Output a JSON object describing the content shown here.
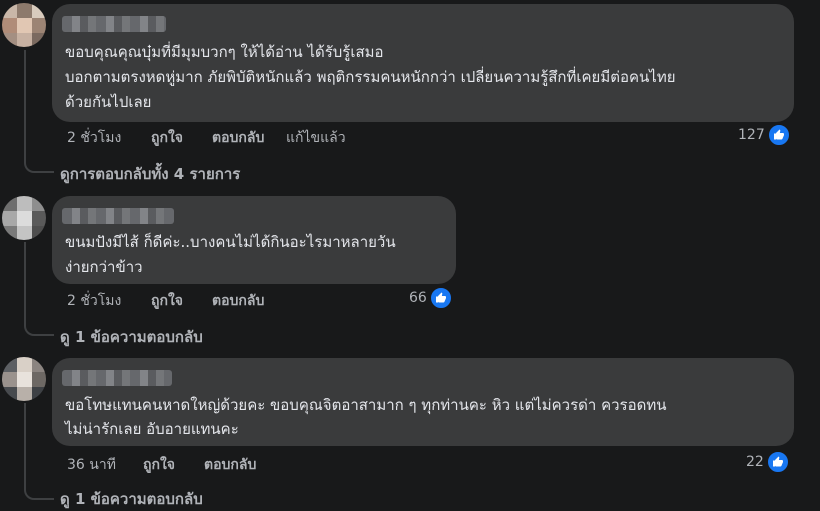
{
  "comments": [
    {
      "lines": [
        "ขอบคุณคุณบุ๋มที่มีมุมบวกๆ ให้ได้อ่าน ได้รับรู้เสมอ",
        "บอกตามตรงหดหู่มาก ภัยพิบัติหนักแล้ว พฤติกรรมคนหนักกว่า เปลี่ยนความรู้สึกที่เคยมีต่อคนไทย",
        "ด้วยกันไปเลย"
      ],
      "time": "2 ชั่วโมง",
      "like": "ถูกใจ",
      "reply": "ตอบกลับ",
      "edited": "แก้ไขแล้ว",
      "reaction_count": "127",
      "replies_link": "ดูการตอบกลับทั้ง 4 รายการ"
    },
    {
      "lines": [
        "ขนมปังมีไส้ ก็ดีค่ะ..บางคนไม่ได้กินอะไรมาหลายวัน",
        "ง่ายกว่าข้าว"
      ],
      "time": "2 ชั่วโมง",
      "like": "ถูกใจ",
      "reply": "ตอบกลับ",
      "reaction_count": "66",
      "replies_link": "ดู 1 ข้อความตอบกลับ"
    },
    {
      "lines": [
        "ขอโทษแทนคนหาดใหญ่ด้วยคะ ขอบคุณจิตอาสามาก ๆ ทุกท่านคะ หิว แต่ไม่ควรด่า ควรอดทน",
        "ไม่น่ารักเลย อับอายแทนคะ"
      ],
      "time": "36 นาที",
      "like": "ถูกใจ",
      "reply": "ตอบกลับ",
      "reaction_count": "22",
      "replies_link": "ดู 1 ข้อความตอบกลับ"
    }
  ],
  "colors": {
    "background": "#18191a",
    "bubble": "#3a3b3c",
    "text": "#e4e6eb",
    "muted": "#b0b3b8",
    "like_badge": "#1877f2"
  },
  "icons": {
    "reaction": "thumbs-up-icon",
    "avatar": "blurred-avatar"
  }
}
